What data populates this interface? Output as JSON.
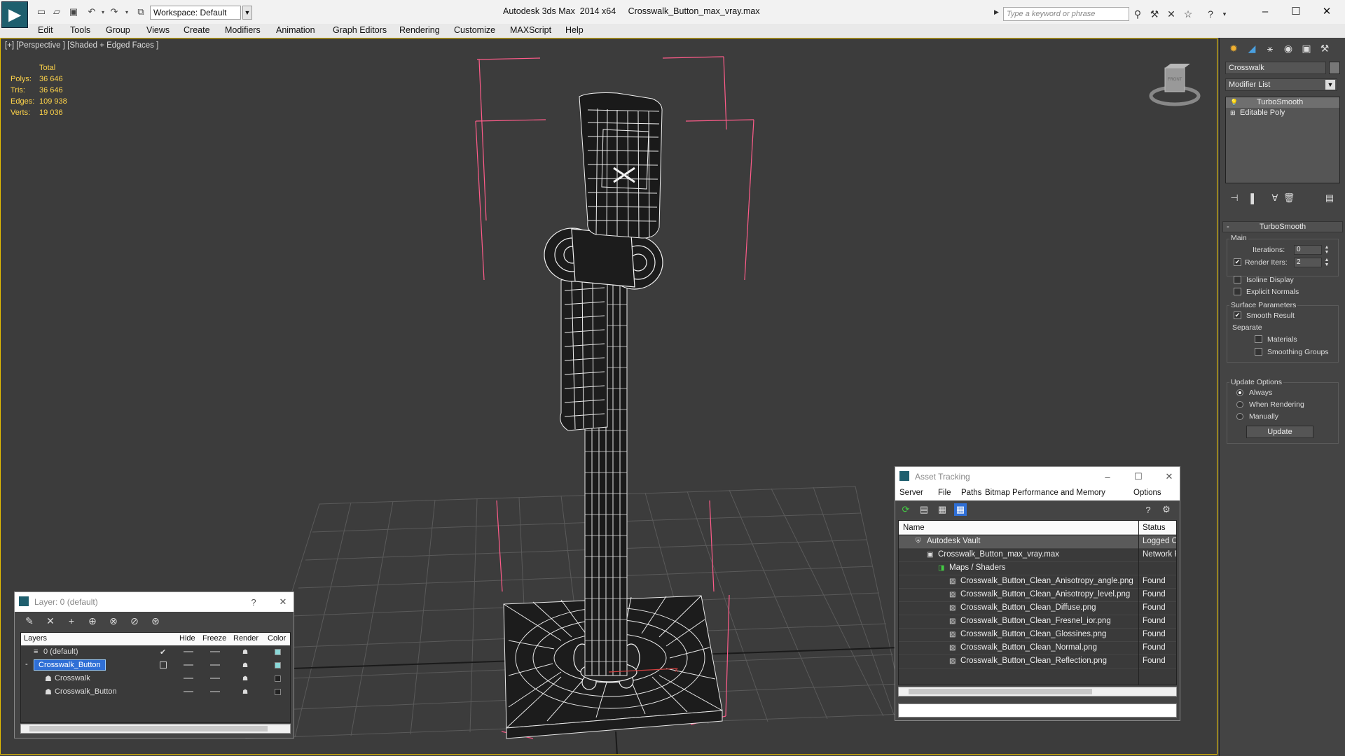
{
  "titlebar": {
    "workspace_label": "Workspace: Default",
    "title": "Autodesk 3ds Max  2014 x64     Crosswalk_Button_max_vray.max",
    "search_placeholder": "Type a keyword or phrase"
  },
  "menu": [
    "Edit",
    "Tools",
    "Group",
    "Views",
    "Create",
    "Modifiers",
    "Animation",
    "Graph Editors",
    "Rendering",
    "Customize",
    "MAXScript",
    "Help"
  ],
  "viewport": {
    "label": "[+] [Perspective ] [Shaded + Edged Faces ]",
    "stats": {
      "header": "Total",
      "rows": [
        {
          "k": "Polys:",
          "v": "36 646"
        },
        {
          "k": "Tris:",
          "v": "36 646"
        },
        {
          "k": "Edges:",
          "v": "109 938"
        },
        {
          "k": "Verts:",
          "v": "19 036"
        }
      ]
    },
    "viewcube_label": "FRONT"
  },
  "command_panel": {
    "object_name": "Crosswalk",
    "modifier_list": "Modifier List",
    "stack": [
      "TurboSmooth",
      "Editable Poly"
    ],
    "turbosmooth": {
      "title": "TurboSmooth",
      "main": "Main",
      "iterations_label": "Iterations:",
      "iterations_value": "0",
      "render_iters_label": "Render Iters:",
      "render_iters_value": "2",
      "isoline": "Isoline Display",
      "explicit_normals": "Explicit Normals",
      "surface_params": "Surface Parameters",
      "smooth_result": "Smooth Result",
      "separate": "Separate",
      "materials": "Materials",
      "smoothing_groups": "Smoothing Groups",
      "update_options": "Update Options",
      "always": "Always",
      "when_rendering": "When Rendering",
      "manually": "Manually",
      "update_button": "Update"
    }
  },
  "layer_dialog": {
    "title": "Layer: 0 (default)",
    "help": "?",
    "columns": [
      "Layers",
      "Hide",
      "Freeze",
      "Render",
      "Color"
    ],
    "rows": [
      {
        "name": "0 (default)",
        "color": "#8ad8d8"
      },
      {
        "name": "Crosswalk_Button",
        "color": "#8ad8d8"
      },
      {
        "name": "Crosswalk",
        "color": "#222222"
      },
      {
        "name": "Crosswalk_Button",
        "color": "#222222"
      }
    ]
  },
  "asset_dialog": {
    "title": "Asset Tracking",
    "menu": [
      "Server",
      "File",
      "Paths",
      "Bitmap Performance and Memory",
      "Options"
    ],
    "columns": [
      "Name",
      "Status"
    ],
    "rows": [
      {
        "name": "Autodesk Vault",
        "status": "Logged O"
      },
      {
        "name": "Crosswalk_Button_max_vray.max",
        "status": "Network F"
      },
      {
        "name": "Maps / Shaders",
        "status": ""
      },
      {
        "name": "Crosswalk_Button_Clean_Anisotropy_angle.png",
        "status": "Found"
      },
      {
        "name": "Crosswalk_Button_Clean_Anisotropy_level.png",
        "status": "Found"
      },
      {
        "name": "Crosswalk_Button_Clean_Diffuse.png",
        "status": "Found"
      },
      {
        "name": "Crosswalk_Button_Clean_Fresnel_ior.png",
        "status": "Found"
      },
      {
        "name": "Crosswalk_Button_Clean_Glossines.png",
        "status": "Found"
      },
      {
        "name": "Crosswalk_Button_Clean_Normal.png",
        "status": "Found"
      },
      {
        "name": "Crosswalk_Button_Clean_Reflection.png",
        "status": "Found"
      }
    ]
  },
  "colors": {
    "stats": "#ffd44a",
    "viewport_border": "#e8c000",
    "selection": "#2f6fd6",
    "bbox": "#ff5c8a"
  }
}
